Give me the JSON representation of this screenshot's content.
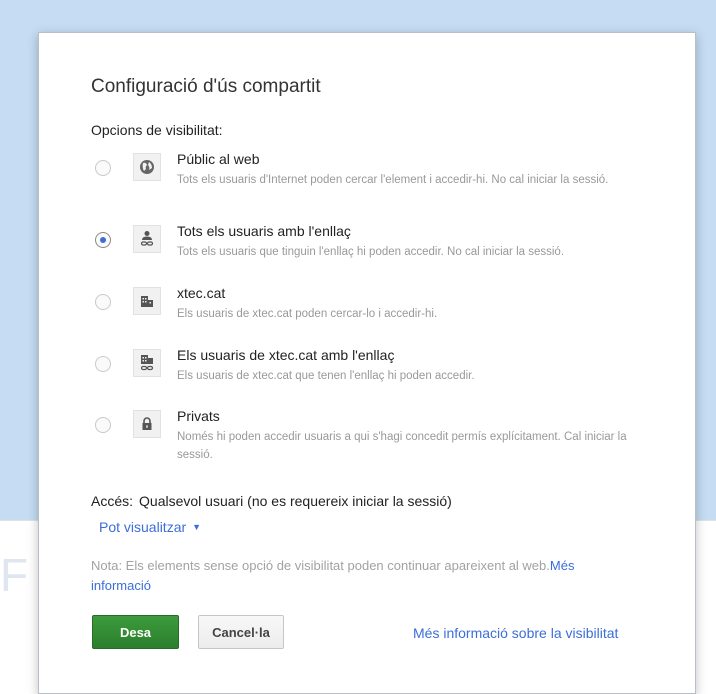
{
  "dialog": {
    "title": "Configuració d'ús compartit",
    "options_label": "Opcions de visibilitat:",
    "options": [
      {
        "icon": "globe-icon",
        "title": "Públic al web",
        "description": "Tots els usuaris d'Internet poden cercar l'element i accedir-hi. No cal iniciar la sessió.",
        "selected": false
      },
      {
        "icon": "person-link-icon",
        "title": "Tots els usuaris amb l'enllaç",
        "description": "Tots els usuaris que tinguin l'enllaç hi poden accedir. No cal iniciar la sessió.",
        "selected": true
      },
      {
        "icon": "building-icon",
        "title": "xtec.cat",
        "description": "Els usuaris de xtec.cat poden cercar-lo i accedir-hi.",
        "selected": false
      },
      {
        "icon": "building-link-icon",
        "title": "Els usuaris de xtec.cat amb l'enllaç",
        "description": "Els usuaris de xtec.cat que tenen l'enllaç hi poden accedir.",
        "selected": false
      },
      {
        "icon": "lock-icon",
        "title": "Privats",
        "description": "Només hi poden accedir usuaris a qui s'hagi concedit permís explícitament. Cal iniciar la sessió.",
        "selected": false
      }
    ],
    "access_label": "Accés:",
    "access_value": "Qualsevol usuari (no es requereix iniciar la sessió)",
    "permission_dropdown": "Pot visualitzar",
    "note_text": "Nota: Els elements sense opció de visibilitat poden continuar apareixent al web.",
    "note_link": "Més informació",
    "save_button": "Desa",
    "cancel_button": "Cancel·la",
    "visibility_link": "Més informació sobre la visibilitat"
  },
  "background_text": "F",
  "colors": {
    "accent_link": "#3b6ed8",
    "save_green": "#2b7f2b",
    "page_bg": "#c6dcf3"
  }
}
